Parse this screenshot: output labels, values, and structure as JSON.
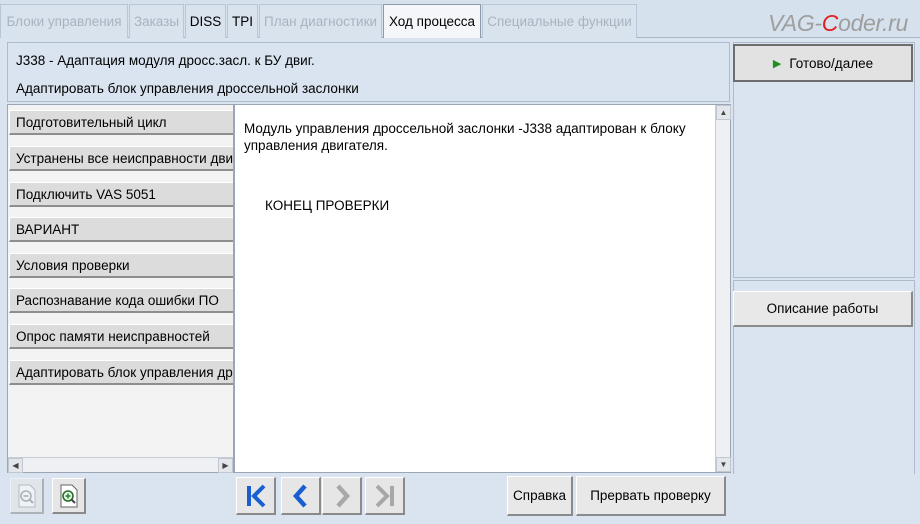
{
  "tabs": [
    {
      "label": "Блоки управления",
      "active": false
    },
    {
      "label": "Заказы",
      "active": false
    },
    {
      "label": "DISS",
      "active": false
    },
    {
      "label": "TPI",
      "active": false
    },
    {
      "label": "План диагностики",
      "active": false
    },
    {
      "label": "Ход процесса",
      "active": true
    },
    {
      "label": "Специальные функции",
      "active": false
    }
  ],
  "brand": {
    "prefix": "VAG-",
    "accent": "C",
    "suffix": "oder.ru"
  },
  "header": {
    "title": "J338 - Адаптация модуля дросс.засл. к БУ двиг.",
    "subtitle": "Адаптировать блок управления дроссельной заслонки"
  },
  "steps": [
    {
      "label": "Подготовительный цикл"
    },
    {
      "label": "Устранены все неисправности двигателя"
    },
    {
      "label": "Подключить VAS 5051"
    },
    {
      "label": "ВАРИАНТ"
    },
    {
      "label": "Условия проверки"
    },
    {
      "label": "Распознавание кода ошибки ПО"
    },
    {
      "label": "Опрос памяти неисправностей"
    },
    {
      "label": "Адаптировать блок управления дроссельной заслонки"
    }
  ],
  "main": {
    "message": "Модуль управления дроссельной заслонки -J338 адаптирован к блоку управления двигателя.",
    "end_text": "КОНЕЦ ПРОВЕРКИ"
  },
  "right_panel": {
    "ready_label": "Готово/далее",
    "description_label": "Описание работы"
  },
  "toolbar": {
    "help_label": "Справка",
    "abort_label": "Прервать проверку"
  },
  "icons": {
    "zoom_out": "zoom-out-icon",
    "zoom_in": "zoom-in-icon",
    "first": "first-page-icon",
    "prev": "previous-icon",
    "next": "next-icon",
    "last": "last-page-icon",
    "play": "play-icon"
  },
  "colors": {
    "accent_blue": "#1a5fd0",
    "play_green": "#1f8f1f",
    "brand_red": "#e02020",
    "background": "#d9e4f0"
  }
}
